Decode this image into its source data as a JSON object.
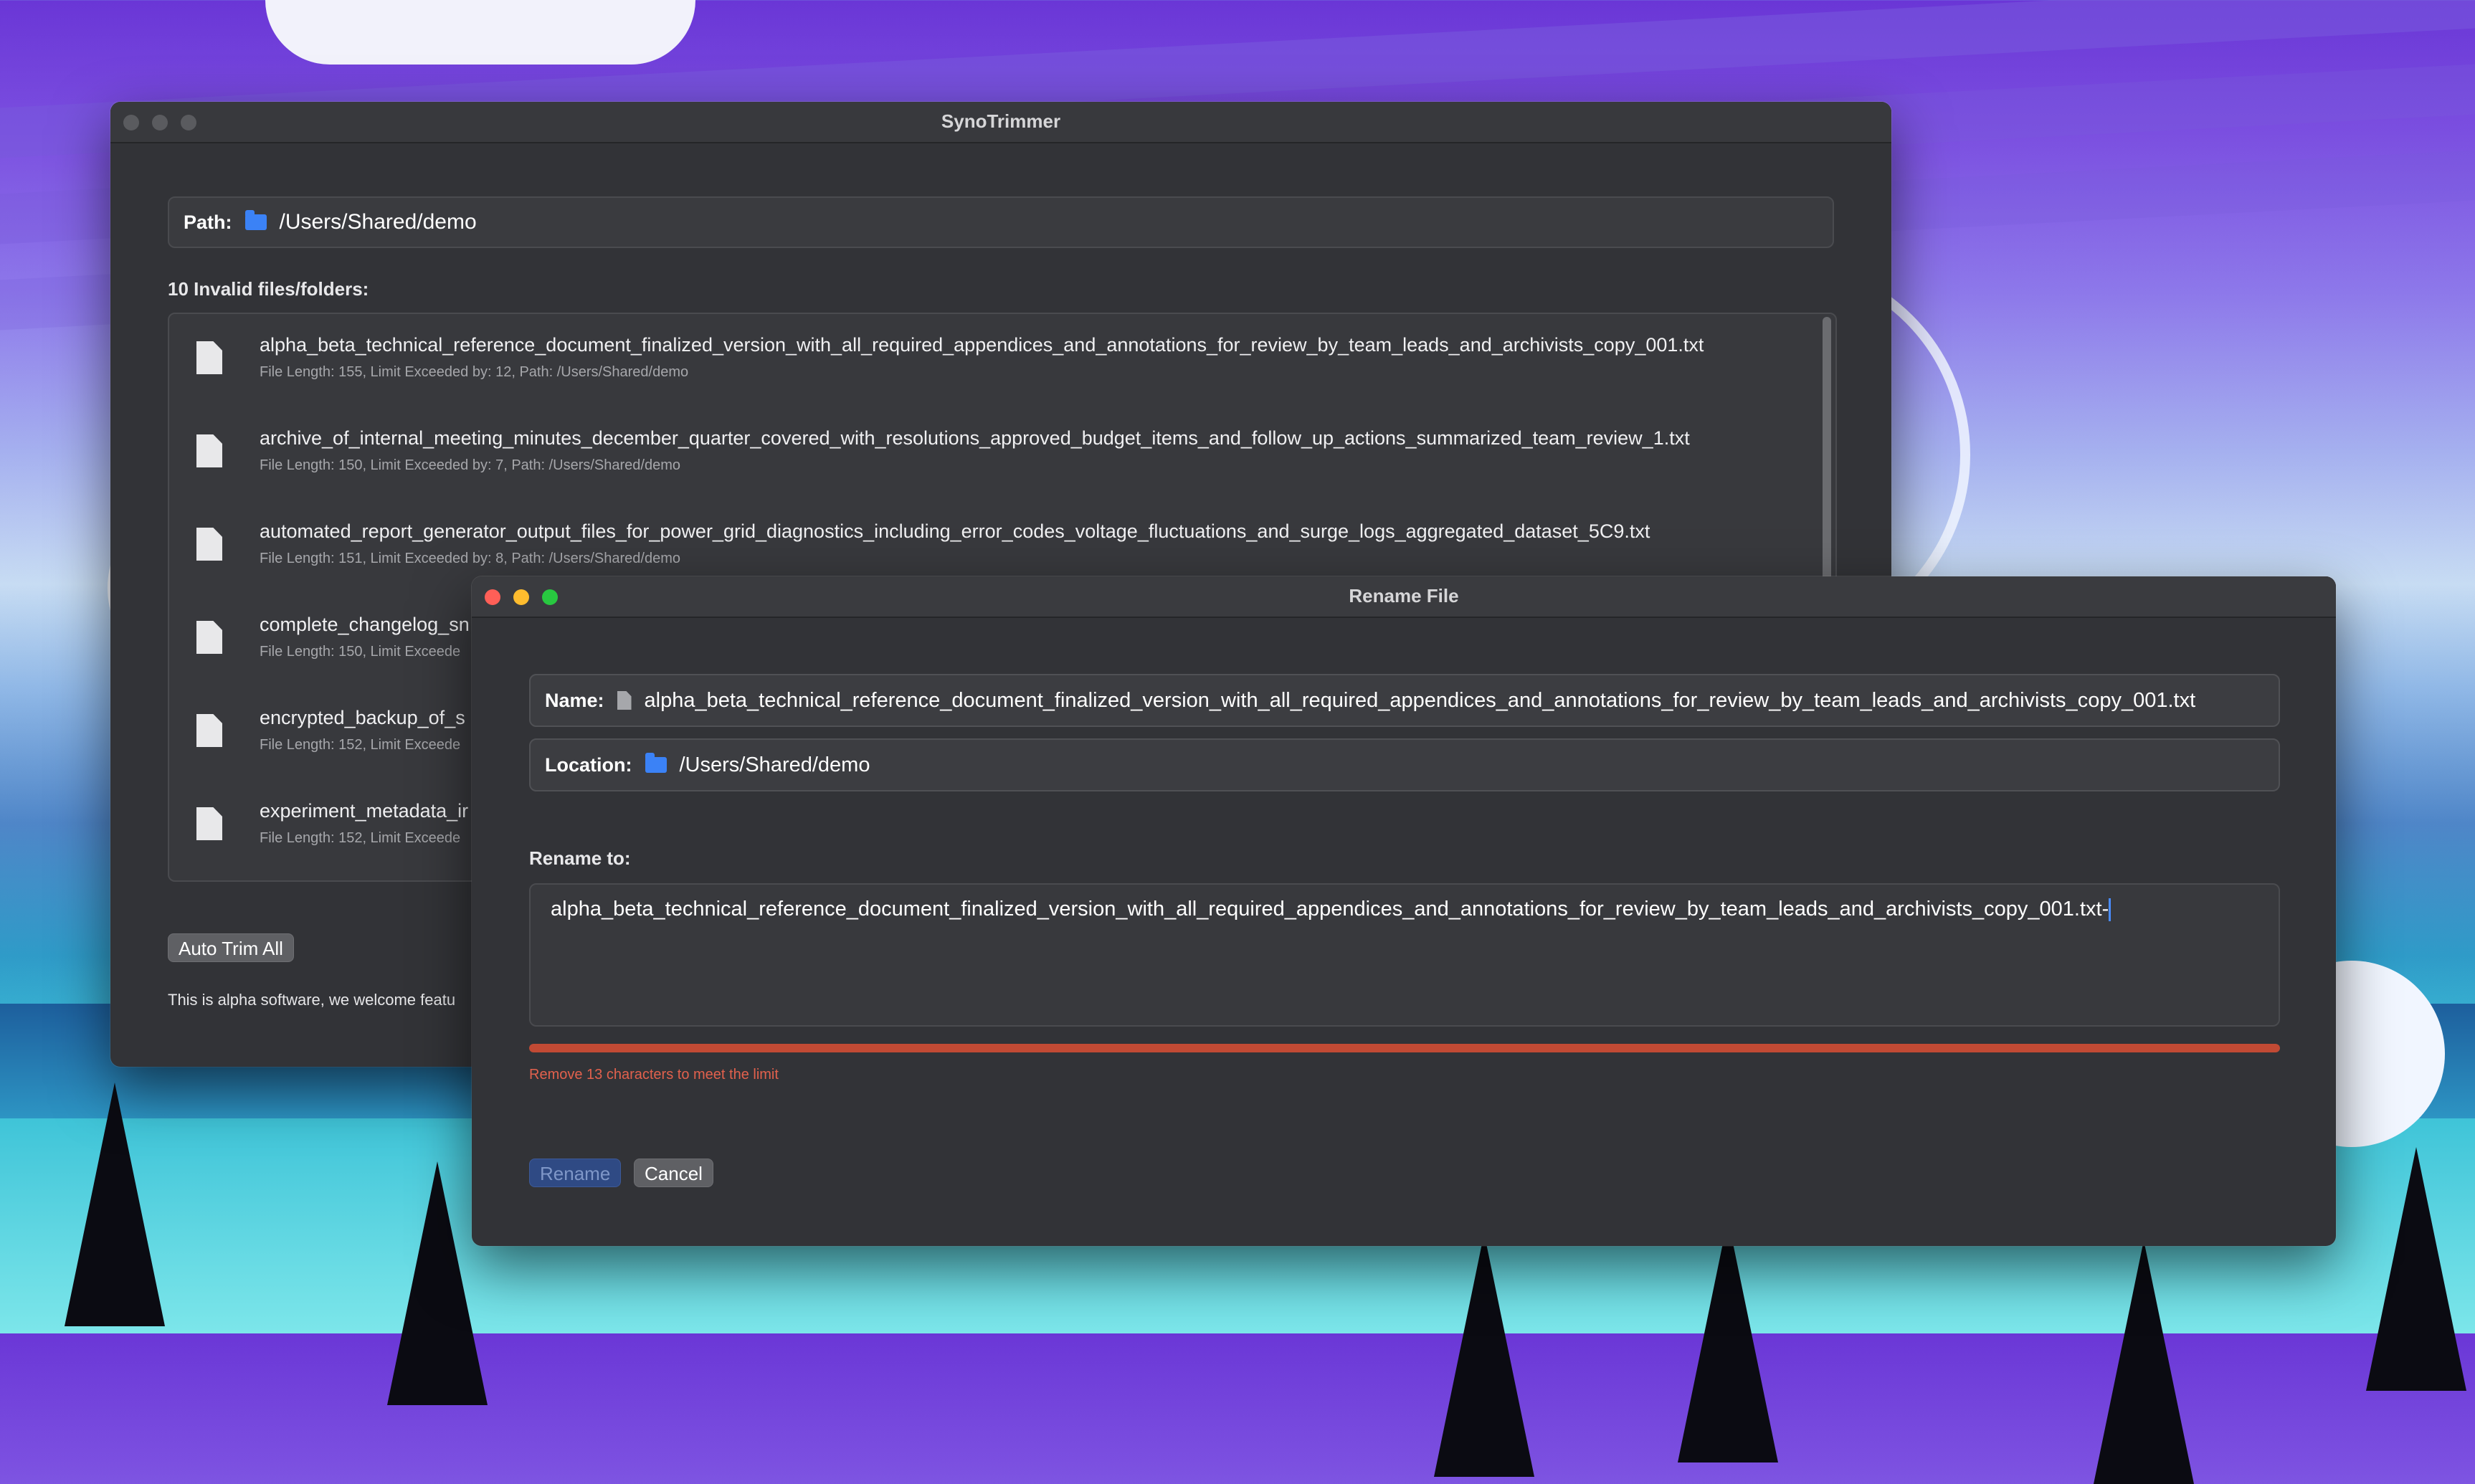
{
  "main_window": {
    "title": "SynoTrimmer",
    "path_label": "Path:",
    "path_value": "/Users/Shared/demo",
    "section_title": "10 Invalid files/folders:",
    "files": [
      {
        "name": "alpha_beta_technical_reference_document_finalized_version_with_all_required_appendices_and_annotations_for_review_by_team_leads_and_archivists_copy_001.txt",
        "meta": "File Length: 155, Limit Exceeded by: 12, Path: /Users/Shared/demo"
      },
      {
        "name": "archive_of_internal_meeting_minutes_december_quarter_covered_with_resolutions_approved_budget_items_and_follow_up_actions_summarized_team_review_1.txt",
        "meta": "File Length: 150, Limit Exceeded by: 7, Path: /Users/Shared/demo"
      },
      {
        "name": "automated_report_generator_output_files_for_power_grid_diagnostics_including_error_codes_voltage_fluctuations_and_surge_logs_aggregated_dataset_5C9.txt",
        "meta": "File Length: 151, Limit Exceeded by: 8, Path: /Users/Shared/demo"
      },
      {
        "name": "complete_changelog_sn",
        "meta": "File Length: 150, Limit Exceede"
      },
      {
        "name": "encrypted_backup_of_s",
        "meta": "File Length: 152, Limit Exceede"
      },
      {
        "name": "experiment_metadata_ir",
        "meta": "File Length: 152, Limit Exceede"
      }
    ],
    "auto_trim_label": "Auto Trim All",
    "footer_text": "This is alpha software, we welcome featu"
  },
  "rename_dialog": {
    "title": "Rename File",
    "name_label": "Name:",
    "name_value": "alpha_beta_technical_reference_document_finalized_version_with_all_required_appendices_and_annotations_for_review_by_team_leads_and_archivists_copy_001.txt",
    "location_label": "Location:",
    "location_value": "/Users/Shared/demo",
    "rename_to_label": "Rename to:",
    "rename_to_value": "alpha_beta_technical_reference_document_finalized_version_with_all_required_appendices_and_annotations_for_review_by_team_leads_and_archivists_copy_001.txt-",
    "limit_progress": 1.0,
    "error_text": "Remove 13 characters to meet the limit",
    "rename_button": "Rename",
    "cancel_button": "Cancel"
  },
  "colors": {
    "accent_blue": "#3b82f6",
    "error_red": "#c24a34",
    "close": "#ff5f57",
    "minimize": "#febc2e",
    "zoom": "#28c840"
  },
  "icons": {
    "folder": "folder-icon",
    "file": "file-icon"
  }
}
